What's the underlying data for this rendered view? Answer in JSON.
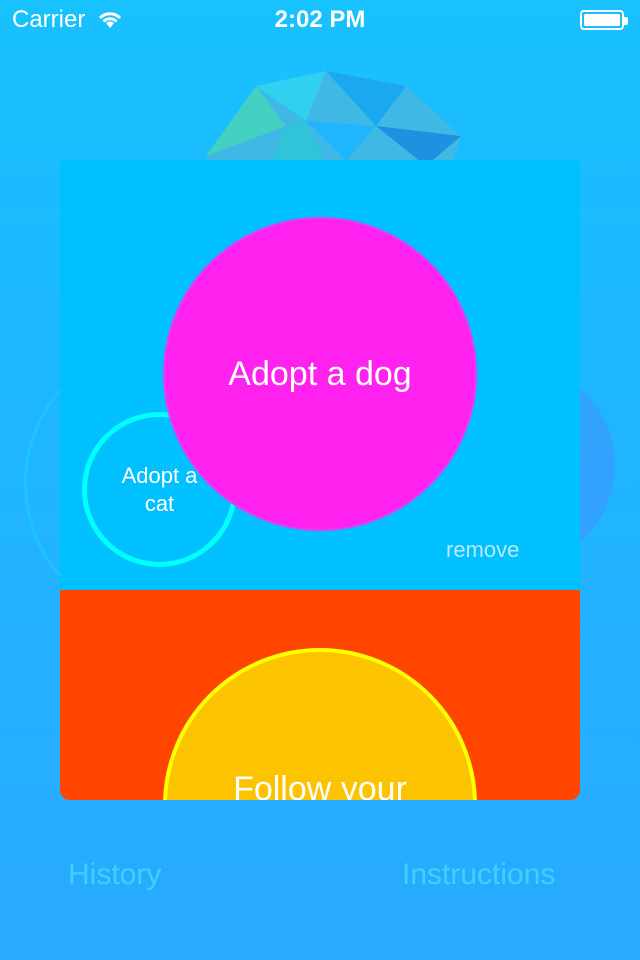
{
  "status_bar": {
    "carrier": "Carrier",
    "time": "2:02 PM"
  },
  "bubbles": {
    "dog": "Adopt a dog",
    "cat": "Adopt a cat",
    "follow": "Follow your",
    "remove": "remove"
  },
  "nav": {
    "history": "History",
    "instructions": "Instructions"
  },
  "colors": {
    "background": "#1fb6ff",
    "card_top": "#00c0ff",
    "card_bottom": "#ff4500",
    "dog_bubble": "#ff22ee",
    "cat_ring": "#00ffff",
    "follow_bubble": "#fbc300",
    "follow_ring": "#ffff00"
  }
}
